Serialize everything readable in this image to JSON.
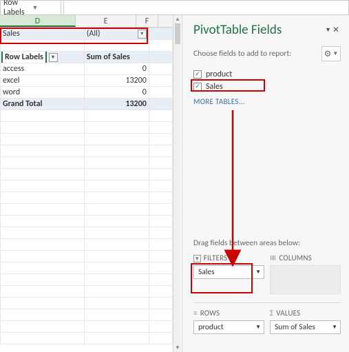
{
  "namebox": {
    "value": "Row Labels"
  },
  "columns": [
    "D",
    "E",
    "F"
  ],
  "grid": {
    "filter_label": "Sales",
    "filter_value": "(All)",
    "pivot_hdr_a": "Row Labels",
    "pivot_hdr_b": "Sum of Sales",
    "rows": [
      {
        "label": "access",
        "value": "0"
      },
      {
        "label": "excel",
        "value": "13200"
      },
      {
        "label": "word",
        "value": "0"
      }
    ],
    "total_label": "Grand Total",
    "total_value": "13200"
  },
  "panel": {
    "title": "PivotTable Fields",
    "choose_label": "Choose fields to add to report:",
    "fields": [
      {
        "name": "product",
        "checked": true
      },
      {
        "name": "Sales",
        "checked": true
      }
    ],
    "more_tables": "MORE TABLES...",
    "drag_label": "Drag fields between areas below:",
    "areas": {
      "filters": {
        "title": "FILTERS",
        "item": "Sales"
      },
      "columns": {
        "title": "COLUMNS"
      },
      "rows": {
        "title": "ROWS",
        "item": "product"
      },
      "values": {
        "title": "VALUES",
        "item": "Sum of Sales"
      }
    }
  }
}
